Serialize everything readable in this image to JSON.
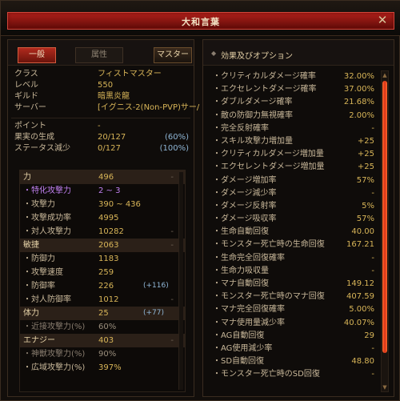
{
  "window": {
    "title": "大和言葉"
  },
  "tabs": {
    "general": "一般",
    "attribute": "属性",
    "master": "マスター"
  },
  "info": [
    {
      "k": "クラス",
      "v": "フィストマスター",
      "p": ""
    },
    {
      "k": "レベル",
      "v": "550",
      "p": ""
    },
    {
      "k": "ギルド",
      "v": "暗黒炎龍",
      "p": ""
    },
    {
      "k": "サーバー",
      "v": "[イグニス-2(Non-PVP)サー/",
      "p": ""
    }
  ],
  "info2": [
    {
      "k": "ポイント",
      "v": "-",
      "p": ""
    },
    {
      "k": "果実の生成",
      "v": "20/127",
      "p": "(60%)"
    },
    {
      "k": "ステータス減少",
      "v": "0/127",
      "p": "(100%)"
    }
  ],
  "stats": [
    {
      "k": "力",
      "v": "496",
      "b": "",
      "d": "-",
      "cls": "head"
    },
    {
      "k": "・特化攻撃力",
      "v": "2 ~ 3",
      "b": "",
      "d": "",
      "cls": "hl"
    },
    {
      "k": "・攻撃力",
      "v": "390 ~ 436",
      "b": "",
      "d": "",
      "cls": ""
    },
    {
      "k": "・攻撃成功率",
      "v": "4995",
      "b": "",
      "d": "",
      "cls": ""
    },
    {
      "k": "・対人攻撃力",
      "v": "10282",
      "b": "",
      "d": "-",
      "cls": ""
    },
    {
      "k": "敏捷",
      "v": "2063",
      "b": "",
      "d": "-",
      "cls": "head"
    },
    {
      "k": "・防御力",
      "v": "1183",
      "b": "",
      "d": "",
      "cls": ""
    },
    {
      "k": "・攻撃速度",
      "v": "259",
      "b": "",
      "d": "",
      "cls": ""
    },
    {
      "k": "・防御率",
      "v": "226",
      "b": "(+116)",
      "d": "",
      "cls": ""
    },
    {
      "k": "・対人防御率",
      "v": "1012",
      "b": "",
      "d": "-",
      "cls": ""
    },
    {
      "k": "体力",
      "v": "25",
      "b": "(+77)",
      "d": "",
      "cls": "head"
    },
    {
      "k": "・近接攻撃力(%)",
      "v": "60%",
      "b": "",
      "d": "",
      "cls": "dim"
    },
    {
      "k": "エナジー",
      "v": "403",
      "b": "",
      "d": "-",
      "cls": "head"
    },
    {
      "k": "・神獣攻撃力(%)",
      "v": "90%",
      "b": "",
      "d": "",
      "cls": "dim"
    },
    {
      "k": "・広域攻撃力(%)",
      "v": "397%",
      "b": "",
      "d": "",
      "cls": ""
    }
  ],
  "options_title": "効果及びオプション",
  "options": [
    {
      "k": "・クリティカルダメージ確率",
      "v": "32.00%"
    },
    {
      "k": "・エクセレントダメージ確率",
      "v": "37.00%"
    },
    {
      "k": "・ダブルダメージ確率",
      "v": "21.68%"
    },
    {
      "k": "・敵の防御力無視確率",
      "v": "2.00%"
    },
    {
      "k": "・完全反射確率",
      "v": "-"
    },
    {
      "k": "・スキル攻撃力増加量",
      "v": "+25"
    },
    {
      "k": "・クリティカルダメージ増加量",
      "v": "+25"
    },
    {
      "k": "・エクセレントダメージ増加量",
      "v": "+25"
    },
    {
      "k": "・ダメージ増加率",
      "v": "57%"
    },
    {
      "k": "・ダメージ減少率",
      "v": "-"
    },
    {
      "k": "・ダメージ反射率",
      "v": "5%"
    },
    {
      "k": "・ダメージ吸収率",
      "v": "57%"
    },
    {
      "k": "・生命自動回復",
      "v": "40.00"
    },
    {
      "k": "・モンスター死亡時の生命回復",
      "v": "167.21"
    },
    {
      "k": "・生命完全回復確率",
      "v": "-"
    },
    {
      "k": "・生命力吸収量",
      "v": "-"
    },
    {
      "k": "・マナ自動回復",
      "v": "149.12"
    },
    {
      "k": "・モンスター死亡時のマナ回復",
      "v": "407.59"
    },
    {
      "k": "・マナ完全回復確率",
      "v": "5.00%"
    },
    {
      "k": "・マナ使用量減少率",
      "v": "40.07%"
    },
    {
      "k": "・AG自動回復",
      "v": "29"
    },
    {
      "k": "・AG使用減少率",
      "v": "-"
    },
    {
      "k": "・SD自動回復",
      "v": "48.80"
    },
    {
      "k": "・モンスター死亡時のSD回復",
      "v": "-"
    }
  ],
  "colors": {
    "accent": "#b0201a",
    "value": "#d8b558",
    "bonus": "#8fb6d6",
    "special": "#c080f0"
  },
  "icons": {
    "close": "close-icon",
    "options_bullet": "bullet-icon"
  }
}
